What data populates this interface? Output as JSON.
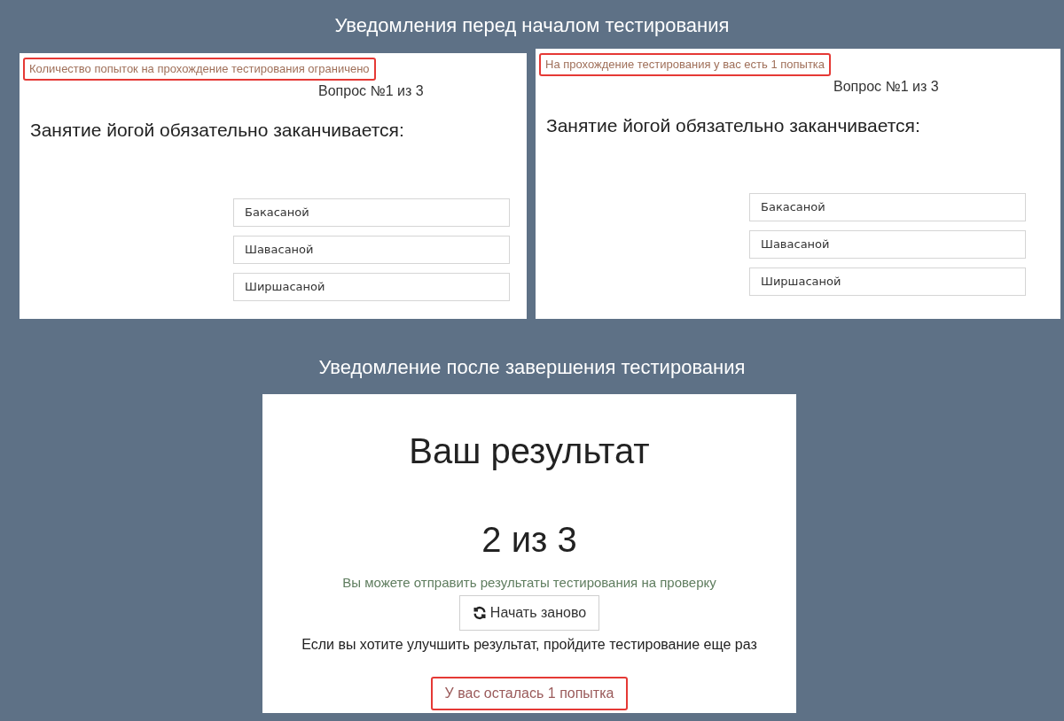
{
  "top_heading": "Уведомления перед началом тестирования",
  "quiz_panels": [
    {
      "notice": "Количество попыток на прохождение тестирования ограничено",
      "counter": "Вопрос №1 из 3",
      "question": "Занятие йогой обязательно заканчивается:",
      "answers": [
        "Бакасаной",
        "Шавасаной",
        "Ширшасаной"
      ]
    },
    {
      "notice": "На прохождение тестирования у вас есть 1 попытка",
      "counter": "Вопрос №1 из 3",
      "question": "Занятие йогой обязательно заканчивается:",
      "answers": [
        "Бакасаной",
        "Шавасаной",
        "Ширшасаной"
      ]
    }
  ],
  "bottom_heading": "Уведомление после завершения тестирования",
  "result_panel": {
    "title": "Ваш результат",
    "score": "2 из 3",
    "submit_note": "Вы можете отправить результаты тестирования на проверку",
    "restart_button": "Начать заново",
    "improve_note": "Если вы хотите улучшить результат, пройдите тестирование еще раз",
    "attempts_notice": "У вас осталась 1 попытка"
  }
}
